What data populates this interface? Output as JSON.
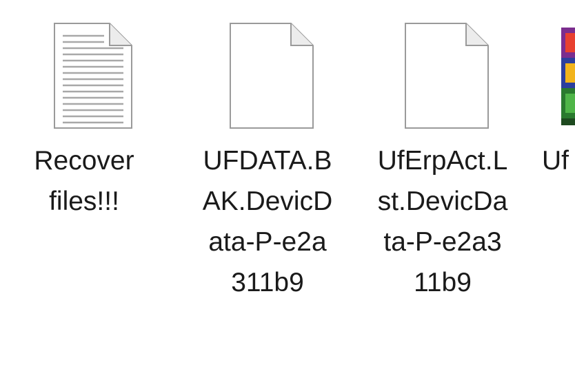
{
  "files": [
    {
      "label": "Recover\nfiles!!!",
      "icon": "text-document-icon"
    },
    {
      "label": "UFDATA.B\nAK.DevicD\nata-P-e2a\n311b9",
      "icon": "blank-document-icon"
    },
    {
      "label": "UfErpAct.L\nst.DevicDa\nta-P-e2a3\n11b9",
      "icon": "blank-document-icon"
    },
    {
      "label": "Uf",
      "icon": "winrar-archive-icon"
    }
  ]
}
